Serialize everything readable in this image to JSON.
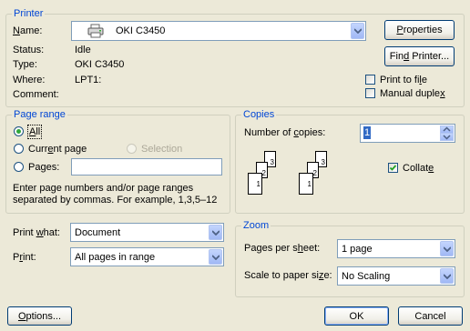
{
  "printer": {
    "group_title": "Printer",
    "name_label_pre": "N",
    "name_label_rest": "ame:",
    "name_value": "OKI C3450",
    "status_label": "Status:",
    "status_value": "Idle",
    "type_label": "Type:",
    "type_value": "OKI C3450",
    "where_label": "Where:",
    "where_value": "LPT1:",
    "comment_label": "Comment:",
    "comment_value": "",
    "properties_pre": "P",
    "properties_rest": "roperties",
    "find_printer_pre": "Fin",
    "find_printer_key": "d",
    "find_printer_rest": " Printer...",
    "print_to_file_pre": "Print to fi",
    "print_to_file_key": "l",
    "print_to_file_rest": "e",
    "print_to_file_checked": false,
    "manual_duplex_pre": "Manual duple",
    "manual_duplex_key": "x",
    "manual_duplex_checked": false
  },
  "page_range": {
    "group_title": "Page range",
    "all_key": "A",
    "all_rest": "ll",
    "current_pre": "Curr",
    "current_key": "e",
    "current_rest": "nt page",
    "selection_label": "Selection",
    "pages_pre": "Pa",
    "pages_key": "g",
    "pages_rest": "es:",
    "pages_value": "",
    "hint_line1": "Enter page numbers and/or page ranges",
    "hint_line2": "separated by commas.  For example, 1,3,5–12",
    "selected": "all"
  },
  "copies": {
    "group_title": "Copies",
    "number_label_pre": "Number of ",
    "number_label_key": "c",
    "number_label_rest": "opies:",
    "number_value": "1",
    "collate_pre": "Collat",
    "collate_key": "e",
    "collate_checked": true,
    "collate_icon_pages": [
      "3",
      "2",
      "1",
      "3",
      "2",
      "1"
    ]
  },
  "print_what": {
    "label_pre": "Print ",
    "label_key": "w",
    "label_rest": "hat:",
    "value": "Document"
  },
  "print": {
    "label_pre": "P",
    "label_key": "r",
    "label_rest": "int:",
    "value": "All pages in range"
  },
  "zoom": {
    "group_title": "Zoom",
    "pages_per_sheet_pre": "Pages per s",
    "pages_per_sheet_key": "h",
    "pages_per_sheet_rest": "eet:",
    "pages_per_sheet_value": "1 page",
    "scale_pre": "Scale to paper si",
    "scale_key": "z",
    "scale_rest": "e:",
    "scale_value": "No Scaling"
  },
  "footer": {
    "options_pre": "",
    "options_key": "O",
    "options_rest": "ptions...",
    "ok_label": "OK",
    "cancel_label": "Cancel"
  }
}
